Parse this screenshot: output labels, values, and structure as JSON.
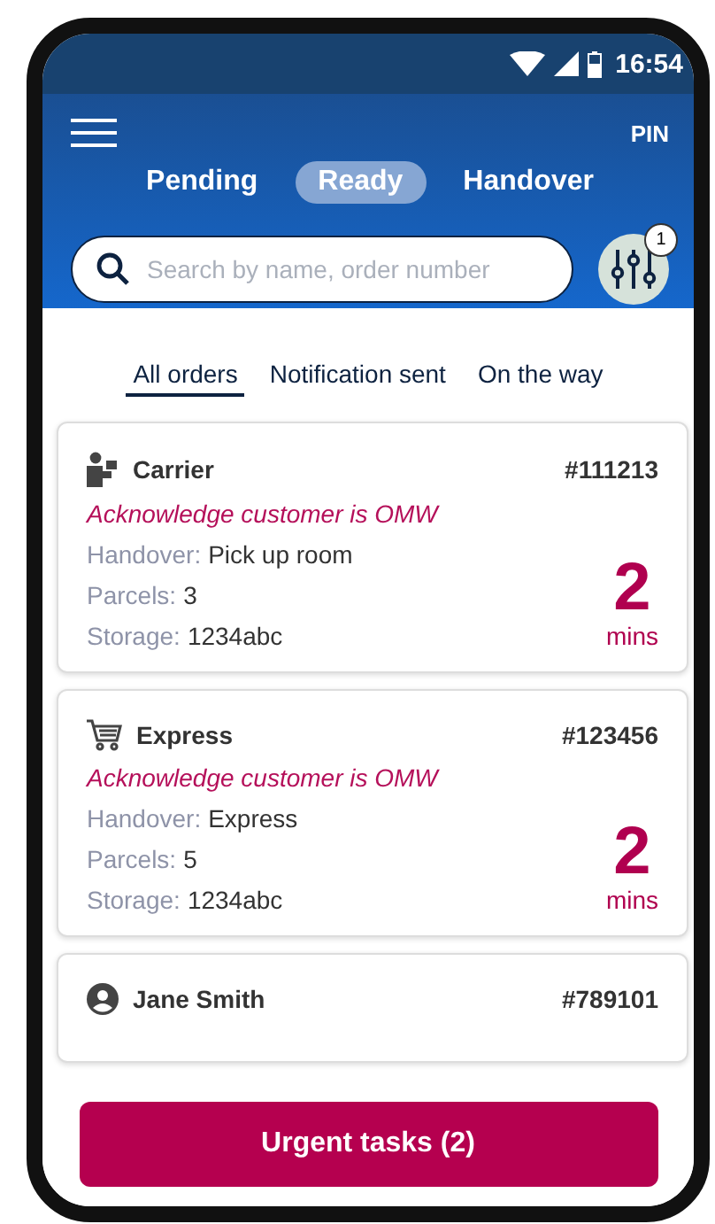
{
  "status_bar": {
    "time": "16:54"
  },
  "header": {
    "pin": "PIN"
  },
  "tabs": [
    {
      "label": "Pending",
      "selected": false
    },
    {
      "label": "Ready",
      "selected": true
    },
    {
      "label": "Handover",
      "selected": false
    }
  ],
  "search": {
    "placeholder": "Search by name, order number"
  },
  "filter": {
    "badge": "1"
  },
  "subtabs": [
    {
      "label": "All orders",
      "selected": true
    },
    {
      "label": "Notification sent",
      "selected": false
    },
    {
      "label": "On the way",
      "selected": false
    }
  ],
  "orders": [
    {
      "kind": "carrier",
      "name": "Carrier",
      "number": "#111213",
      "task": "Acknowledge customer is OMW",
      "fields": [
        {
          "label": "Handover:",
          "value": "Pick up room"
        },
        {
          "label": "Parcels:",
          "value": "3"
        },
        {
          "label": "Storage:",
          "value": "1234abc"
        }
      ],
      "time": "2",
      "unit": "mins"
    },
    {
      "kind": "cart",
      "name": "Express",
      "number": "#123456",
      "task": "Acknowledge customer is OMW",
      "fields": [
        {
          "label": "Handover:",
          "value": "Express"
        },
        {
          "label": "Parcels:",
          "value": "5"
        },
        {
          "label": "Storage:",
          "value": "1234abc"
        }
      ],
      "time": "2",
      "unit": "mins"
    },
    {
      "kind": "person",
      "name": "Jane Smith",
      "number": "#789101"
    }
  ],
  "footer": {
    "button": "Urgent tasks (2)"
  }
}
